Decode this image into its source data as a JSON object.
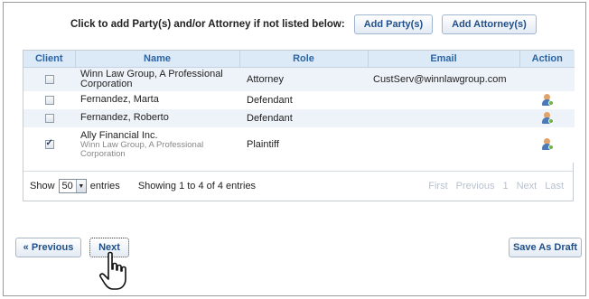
{
  "top": {
    "prompt": "Click to add Party(s) and/or Attorney if not listed below:",
    "add_party": "Add Party(s)",
    "add_attorney": "Add Attorney(s)"
  },
  "table": {
    "headers": {
      "client": "Client",
      "name": "Name",
      "role": "Role",
      "email": "Email",
      "action": "Action"
    },
    "rows": [
      {
        "name": "Winn Law Group, A Professional Corporation",
        "sub": "",
        "role": "Attorney",
        "email": "CustServ@winnlawgroup.com",
        "checked": false,
        "action_icon": ""
      },
      {
        "name": "Fernandez, Marta",
        "sub": "",
        "role": "Defendant",
        "email": "",
        "checked": false,
        "action_icon": "person-edit-icon"
      },
      {
        "name": "Fernandez, Roberto",
        "sub": "",
        "role": "Defendant",
        "email": "",
        "checked": false,
        "action_icon": "person-edit-icon"
      },
      {
        "name": "Ally Financial Inc.",
        "sub": "Winn Law Group, A Professional Corporation",
        "role": "Plaintiff",
        "email": "",
        "checked": true,
        "action_icon": "person-edit-icon"
      }
    ]
  },
  "footer": {
    "show": "Show",
    "page_size": "50",
    "entries": "entries",
    "info": "Showing 1 to 4 of 4 entries",
    "pager": {
      "first": "First",
      "previous": "Previous",
      "page": "1",
      "next": "Next",
      "last": "Last"
    }
  },
  "nav": {
    "previous": "« Previous",
    "next": "Next",
    "save_draft": "Save As Draft"
  },
  "colors": {
    "accent": "#1f4f8a",
    "header_bg": "#dce9f6",
    "row_alt": "#eef3f9"
  }
}
